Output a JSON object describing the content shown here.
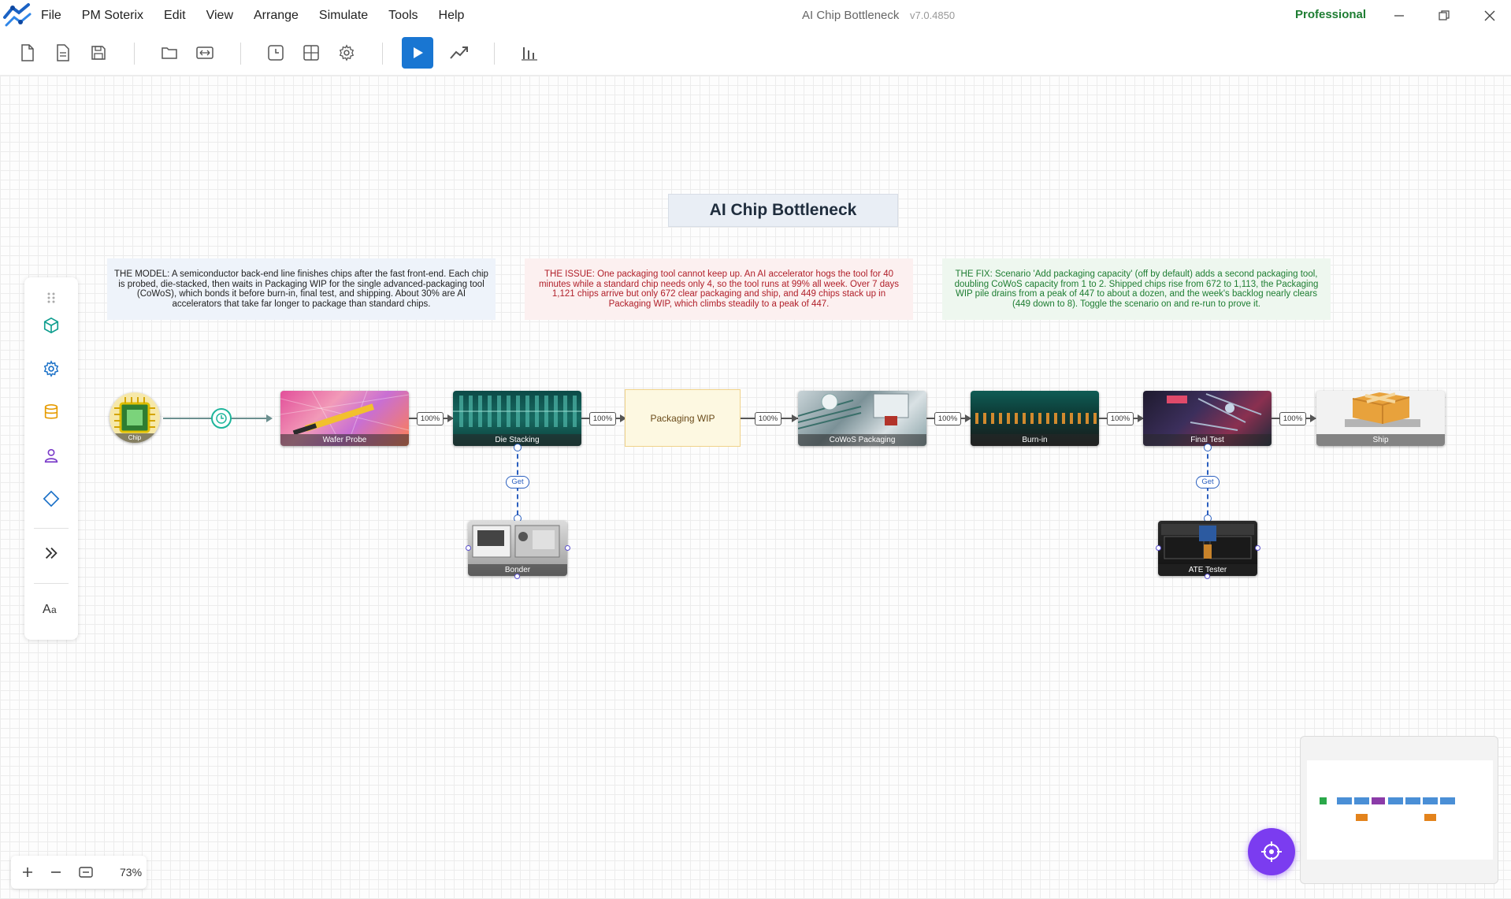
{
  "app": {
    "menu": [
      "File",
      "PM Soterix",
      "Edit",
      "View",
      "Arrange",
      "Simulate",
      "Tools",
      "Help"
    ],
    "window_title": "AI Chip Bottleneck",
    "version": "v7.0.4850",
    "edition": "Professional"
  },
  "diagram": {
    "title": "AI Chip Bottleneck",
    "notes": {
      "model": "THE MODEL: A semiconductor back-end line finishes chips after the fast front-end. Each chip is probed, die-stacked, then waits in Packaging WIP for the single advanced-packaging tool (CoWoS), which bonds it before burn-in, final test, and shipping. About 30% are AI accelerators that take far longer to package than standard chips.",
      "issue": "THE ISSUE: One packaging tool cannot keep up. An AI accelerator hogs the tool for 40 minutes while a standard chip needs only 4, so the tool runs at 99% all week. Over 7 days 1,121 chips arrive but only 672 clear packaging and ship, and 449 chips stack up in Packaging WIP, which climbs steadily to a peak of 447.",
      "fix": "THE FIX: Scenario 'Add packaging capacity' (off by default) adds a second packaging tool, doubling CoWoS capacity from 1 to 2. Shipped chips rise from 672 to 1,113, the Packaging WIP pile drains from a peak of 447 to about a dozen, and the week's backlog nearly clears (449 down to 8). Toggle the scenario on and re-run to prove it."
    },
    "nodes": {
      "source": "Chip",
      "wafer_probe": "Wafer Probe",
      "die_stacking": "Die Stacking",
      "packaging_wip": "Packaging WIP",
      "cowos": "CoWoS Packaging",
      "burn_in": "Burn-in",
      "final_test": "Final Test",
      "ship": "Ship",
      "bonder": "Bonder",
      "ate_tester": "ATE Tester"
    },
    "connector_pct": "100%",
    "get_label": "Get"
  },
  "zoom": {
    "level": "73%"
  },
  "colors": {
    "accent": "#1976d2",
    "edition": "#1e7d32",
    "issue_text": "#b0202a",
    "fab": "#7b3cf0"
  }
}
